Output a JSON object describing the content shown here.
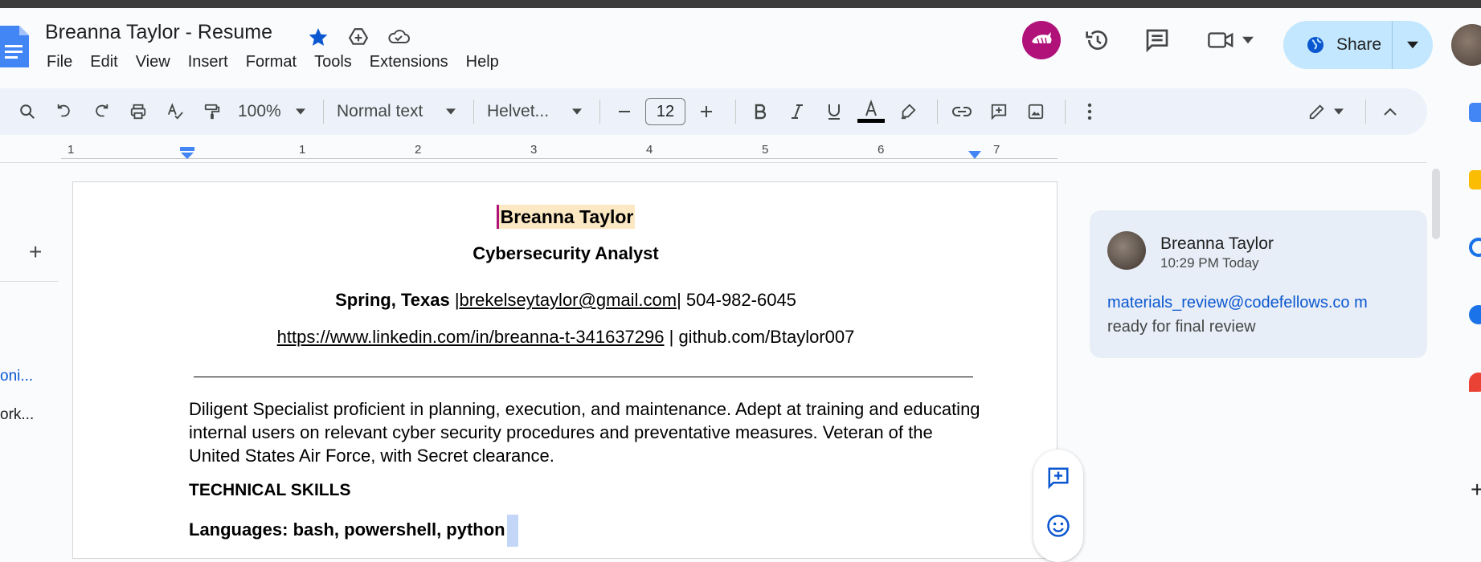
{
  "document": {
    "title": "Breanna Taylor - Resume"
  },
  "menu": [
    "File",
    "Edit",
    "View",
    "Insert",
    "Format",
    "Tools",
    "Extensions",
    "Help"
  ],
  "header": {
    "share_label": "Share",
    "icons": [
      "star-icon",
      "move-to-drive-icon",
      "cloud-saved-icon",
      "collaborator-avatar",
      "version-history-icon",
      "comments-icon",
      "meet-icon",
      "globe-icon"
    ]
  },
  "toolbar": {
    "zoom": "100%",
    "style": "Normal text",
    "font": "Helvet...",
    "font_size": "12",
    "icons": [
      "search-icon",
      "undo-icon",
      "redo-icon",
      "print-icon",
      "spellcheck-icon",
      "paint-format-icon",
      "bold-icon",
      "italic-icon",
      "underline-icon",
      "text-color-icon",
      "highlight-icon",
      "link-icon",
      "add-comment-icon",
      "image-icon",
      "more-icon",
      "editing-mode-icon",
      "collapse-icon"
    ]
  },
  "ruler": {
    "labels": [
      "1",
      "1",
      "2",
      "3",
      "4",
      "5",
      "6",
      "7"
    ]
  },
  "outline": {
    "item1": "oni...",
    "item2": "ork..."
  },
  "resume": {
    "name": "Breanna Taylor",
    "subtitle": "Cybersecurity Analyst",
    "location": "Spring, Texas",
    "sep1": " |",
    "email": "brekelseytaylor@gmail.com",
    "phone": "| 504-982-6045",
    "linkedin": "https://www.linkedin.com/in/breanna-t-341637296",
    "github": " | github.com/Btaylor007",
    "summary": "Diligent Specialist proficient in planning, execution, and maintenance. Adept at training and educating internal users on relevant cyber security procedures and preventative measures. Veteran of the United States Air Force, with Secret clearance.",
    "skills_heading": "TECHNICAL SKILLS",
    "languages": "Languages: bash, powershell, python"
  },
  "comment": {
    "author": "Breanna Taylor",
    "time": "10:29 PM Today",
    "mention": "materials_review@codefellows.co m",
    "text": " ready for final review"
  },
  "colors": {
    "accent": "#0b57d0",
    "share_bg": "#c2e7ff",
    "toolbar_bg": "#edf2fa",
    "highlight": "#fce8c2",
    "cursor": "#b0127a"
  }
}
